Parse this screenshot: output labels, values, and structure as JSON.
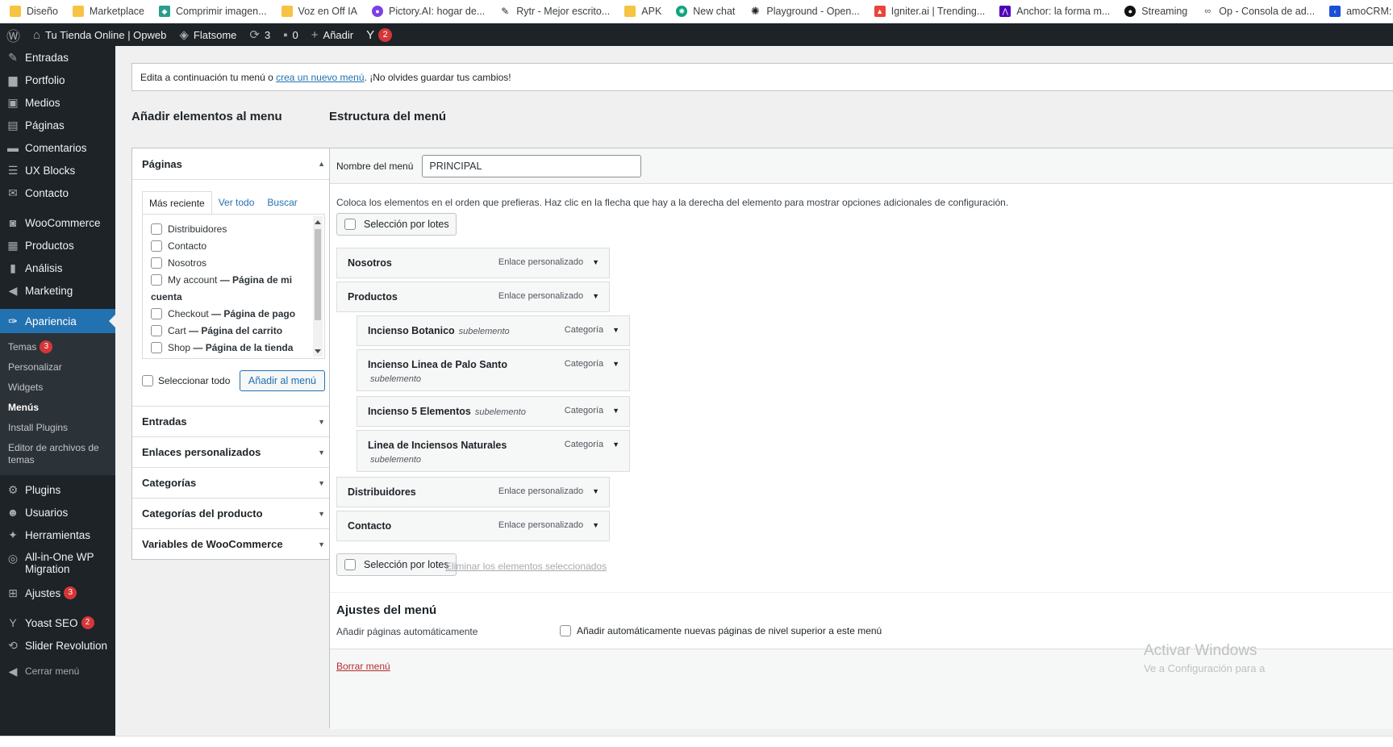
{
  "bookmarks": [
    {
      "label": "Diseño",
      "icon": "folder-icon",
      "color": "#f6c342"
    },
    {
      "label": "Marketplace",
      "icon": "folder-icon",
      "color": "#f6c342"
    },
    {
      "label": "Comprimir imagen...",
      "icon": "compress-icon",
      "color": "#2a9d8f"
    },
    {
      "label": "Voz en Off IA",
      "icon": "folder-icon",
      "color": "#f6c342"
    },
    {
      "label": "Pictory.AI: hogar de...",
      "icon": "pictory-icon",
      "color": "#7b3fe4"
    },
    {
      "label": "Rytr - Mejor escrito...",
      "icon": "rytr-icon",
      "color": "#222222"
    },
    {
      "label": "APK",
      "icon": "folder-icon",
      "color": "#f6c342"
    },
    {
      "label": "New chat",
      "icon": "openai-icon",
      "color": "#10a37f"
    },
    {
      "label": "Playground - Open...",
      "icon": "openai-icon",
      "color": "#222222"
    },
    {
      "label": "Igniter.ai | Trending...",
      "icon": "igniter-icon",
      "color": "#e8453c"
    },
    {
      "label": "Anchor: la forma m...",
      "icon": "anchor-icon",
      "color": "#5000b9"
    },
    {
      "label": "Streaming",
      "icon": "streaming-icon",
      "color": "#111111"
    },
    {
      "label": "Op - Consola de ad...",
      "icon": "op-icon",
      "color": "#555555"
    },
    {
      "label": "amoCRM: Chats, e...",
      "icon": "amocrm-icon",
      "color": "#1b4fd8"
    }
  ],
  "adminbar": {
    "site": "Tu Tienda Online | Opweb",
    "theme": "Flatsome",
    "updates": "3",
    "comments": "0",
    "add": "Añadir",
    "yoast_badge": "2"
  },
  "sidebar": {
    "top": [
      {
        "label": "Entradas",
        "icon": "pin-icon"
      },
      {
        "label": "Portfolio",
        "icon": "portfolio-icon"
      },
      {
        "label": "Medios",
        "icon": "media-icon"
      },
      {
        "label": "Páginas",
        "icon": "page-icon"
      },
      {
        "label": "Comentarios",
        "icon": "comment-icon"
      },
      {
        "label": "UX Blocks",
        "icon": "blocks-icon"
      },
      {
        "label": "Contacto",
        "icon": "mail-icon"
      }
    ],
    "commerce": [
      {
        "label": "WooCommerce",
        "icon": "woo-icon"
      },
      {
        "label": "Productos",
        "icon": "archive-icon"
      },
      {
        "label": "Análisis",
        "icon": "chart-icon"
      },
      {
        "label": "Marketing",
        "icon": "megaphone-icon"
      }
    ],
    "active": {
      "label": "Apariencia",
      "icon": "brush-icon"
    },
    "submenu": [
      {
        "label": "Temas",
        "badge": "3"
      },
      {
        "label": "Personalizar",
        "badge": ""
      },
      {
        "label": "Widgets",
        "badge": ""
      },
      {
        "label": "Menús",
        "badge": "",
        "current": true
      },
      {
        "label": "Install Plugins",
        "badge": ""
      },
      {
        "label": "Editor de archivos de temas",
        "badge": ""
      }
    ],
    "bottom": [
      {
        "label": "Plugins",
        "icon": "plugin-icon",
        "badge": ""
      },
      {
        "label": "Usuarios",
        "icon": "user-icon",
        "badge": ""
      },
      {
        "label": "Herramientas",
        "icon": "wrench-icon",
        "badge": ""
      },
      {
        "label": "All-in-One WP Migration",
        "icon": "migration-icon",
        "badge": ""
      },
      {
        "label": "Ajustes",
        "icon": "settings-icon",
        "badge": "3"
      }
    ],
    "extra": [
      {
        "label": "Yoast SEO",
        "icon": "yoast-icon",
        "badge": "2"
      },
      {
        "label": "Slider Revolution",
        "icon": "slider-icon",
        "badge": ""
      }
    ],
    "collapse": "Cerrar menú"
  },
  "notice": {
    "before": "Edita a continuación tu menú o ",
    "link": "crea un nuevo menú",
    "after": ". ¡No olvides guardar tus cambios!"
  },
  "add_items": {
    "title": "Añadir elementos al menu",
    "pages_section": "Páginas",
    "tabs": [
      "Más reciente",
      "Ver todo",
      "Buscar"
    ],
    "pages": [
      {
        "name": "Distribuidores",
        "suffix": ""
      },
      {
        "name": "Contacto",
        "suffix": ""
      },
      {
        "name": "Nosotros",
        "suffix": ""
      },
      {
        "name": "My account",
        "suffix": " — Página de mi cuenta"
      },
      {
        "name": "Checkout",
        "suffix": " — Página de pago"
      },
      {
        "name": "Cart",
        "suffix": " — Página del carrito"
      },
      {
        "name": "Shop",
        "suffix": " — Página de la tienda"
      }
    ],
    "select_all": "Seleccionar todo",
    "add_button": "Añadir al menú",
    "sections": [
      "Entradas",
      "Enlaces personalizados",
      "Categorías",
      "Categorías del producto",
      "Variables de WooCommerce"
    ]
  },
  "structure": {
    "title": "Estructura del menú",
    "name_label": "Nombre del menú",
    "name_value": "PRINCIPAL",
    "description": "Coloca los elementos en el orden que prefieras. Haz clic en la flecha que hay a la derecha del elemento para mostrar opciones adicionales de configuración.",
    "bulk_label": "Selección por lotes",
    "items": [
      {
        "title": "Nosotros",
        "type": "Enlace personalizado",
        "sub": ""
      },
      {
        "title": "Productos",
        "type": "Enlace personalizado",
        "sub": ""
      },
      {
        "title": "Incienso Botanico",
        "type": "Categoría",
        "sub": "subelemento"
      },
      {
        "title": "Incienso Linea de Palo Santo",
        "type": "Categoría",
        "sub": "subelemento"
      },
      {
        "title": "Incienso 5 Elementos",
        "type": "Categoría",
        "sub": "subelemento"
      },
      {
        "title": "Linea de Inciensos Naturales",
        "type": "Categoría",
        "sub": "subelemento"
      },
      {
        "title": "Distribuidores",
        "type": "Enlace personalizado",
        "sub": ""
      },
      {
        "title": "Contacto",
        "type": "Enlace personalizado",
        "sub": ""
      }
    ],
    "delete_selected": "Eliminar los elementos seleccionados",
    "settings_title": "Ajustes del menú",
    "auto_add_label": "Añadir páginas automáticamente",
    "auto_add_option": "Añadir automáticamente nuevas páginas de nivel superior a este menú",
    "delete_menu": "Borrar menú"
  },
  "watermark": {
    "title": "Activar Windows",
    "subtitle": "Ve a Configuración para a"
  },
  "colors": {
    "accent": "#2271b1",
    "admin_bg": "#1d2327",
    "badge": "#d63638",
    "danger": "#b32d2e"
  }
}
